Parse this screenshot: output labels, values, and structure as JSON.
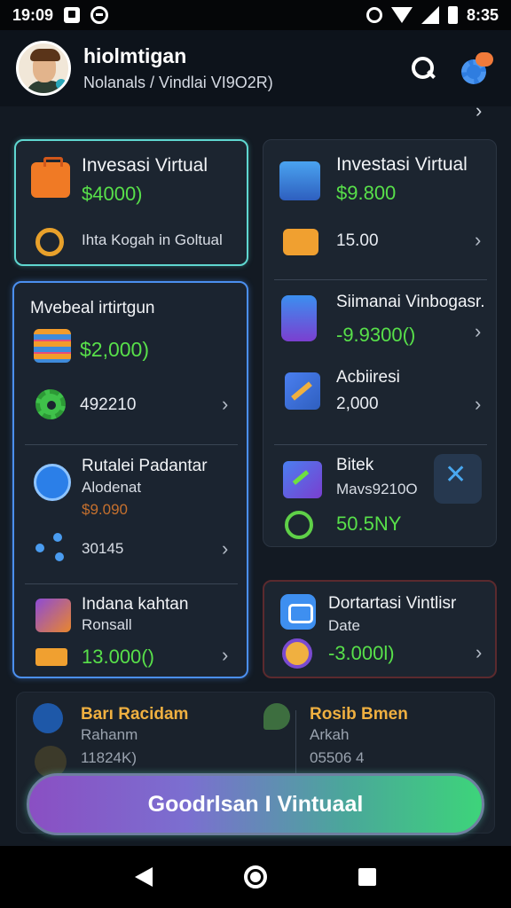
{
  "status_bar": {
    "time_left": "19:09",
    "time_right": "8:35"
  },
  "header": {
    "user_name": "hiolmtigan",
    "user_subtitle": "Nolanals / Vindlai VI9O2R)"
  },
  "cards": {
    "top_left": {
      "title": "Invesasi Virtual",
      "amount": "$4000)",
      "row_label": "Ihta Kogah in Goltual"
    },
    "top_right": {
      "title": "Investasi Virtual",
      "amount": "$9.800",
      "row_value": "15.00"
    },
    "mid_left": {
      "header": "Mvebeal irtirtgun",
      "amount": "$2,000)",
      "gear_value": "492210",
      "entry_title": "Rutalei Padantar",
      "entry_sub": "Alodenat",
      "entry_amount": "$9.090",
      "share_value": "30145",
      "ticket_title": "Indana kahtan",
      "ticket_sub": "Ronsall",
      "ticket_amount": "13.000()"
    },
    "mid_right": {
      "item1_title": "Siimanai Vinbogasr.",
      "item1_amount": "-9.9300()",
      "item2_title": "Acbiiresi",
      "item2_amount": "2,000",
      "item3_title": "Bitek",
      "item3_sub": "Mavs9210O",
      "item3_amount": "50.5NY"
    },
    "right_small": {
      "title": "Dortartasi Vintlisr",
      "sub": "Date",
      "amount": "-3.000l)"
    },
    "bottom": {
      "left_title": "Barı Racidam",
      "left_sub": "Rahanm",
      "left_value": "11824K)",
      "right_title": "Rosib Bmen",
      "right_sub": "Arkah",
      "right_value": "05506 4"
    }
  },
  "cta": {
    "label": "Goodrlsan I Vintuaal"
  }
}
